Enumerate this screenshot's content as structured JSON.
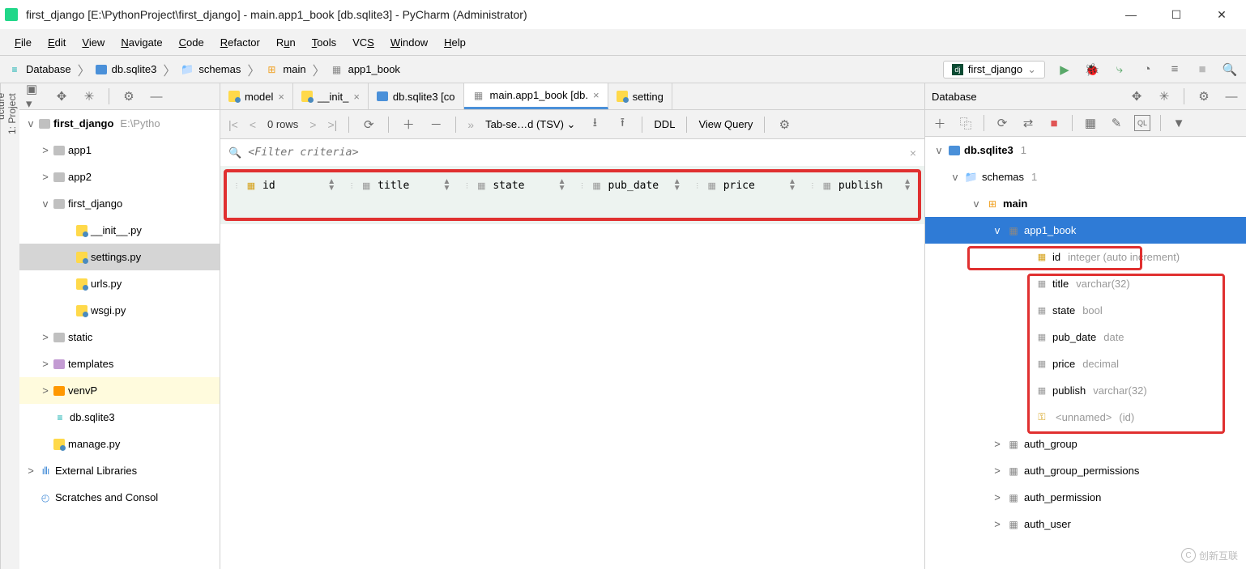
{
  "title": "first_django [E:\\PythonProject\\first_django] - main.app1_book [db.sqlite3] - PyCharm (Administrator)",
  "menubar": [
    "File",
    "Edit",
    "View",
    "Navigate",
    "Code",
    "Refactor",
    "Run",
    "Tools",
    "VCS",
    "Window",
    "Help"
  ],
  "crumbs": [
    {
      "icon": "db",
      "label": "Database"
    },
    {
      "icon": "sqlite",
      "label": "db.sqlite3"
    },
    {
      "icon": "folder",
      "label": "schemas"
    },
    {
      "icon": "schema",
      "label": "main"
    },
    {
      "icon": "table",
      "label": "app1_book"
    }
  ],
  "run_config": "first_django",
  "left_gutter": {
    "tab1": "1: Project",
    "tab2": "ucture"
  },
  "project_tree": {
    "root": {
      "name": "first_django",
      "path": "E:\\Pytho"
    },
    "nodes": [
      {
        "lvl": 1,
        "exp": ">",
        "ic": "greyfolder",
        "label": "app1"
      },
      {
        "lvl": 1,
        "exp": ">",
        "ic": "greyfolder",
        "label": "app2"
      },
      {
        "lvl": 1,
        "exp": "v",
        "ic": "greyfolder",
        "label": "first_django"
      },
      {
        "lvl": 2,
        "exp": "",
        "ic": "pyfile",
        "label": "__init__.py"
      },
      {
        "lvl": 2,
        "exp": "",
        "ic": "pyfile",
        "label": "settings.py",
        "sel": true
      },
      {
        "lvl": 2,
        "exp": "",
        "ic": "pyfile",
        "label": "urls.py"
      },
      {
        "lvl": 2,
        "exp": "",
        "ic": "pyfile",
        "label": "wsgi.py"
      },
      {
        "lvl": 1,
        "exp": ">",
        "ic": "greyfolder",
        "label": "static"
      },
      {
        "lvl": 1,
        "exp": ">",
        "ic": "purplefolder",
        "label": "templates"
      },
      {
        "lvl": 1,
        "exp": ">",
        "ic": "orangefolder",
        "label": "venvP",
        "venv": true
      },
      {
        "lvl": 1,
        "exp": "",
        "ic": "db",
        "label": "db.sqlite3"
      },
      {
        "lvl": 1,
        "exp": "",
        "ic": "pyfile",
        "label": "manage.py"
      }
    ],
    "external": "External Libraries",
    "scratches": "Scratches and Consol"
  },
  "tabs": [
    {
      "ic": "pyfile",
      "label": "model",
      "active": false
    },
    {
      "ic": "pyfile",
      "label": "__init_",
      "active": false
    },
    {
      "ic": "sqlite",
      "label": "db.sqlite3 [co",
      "active": false,
      "noclose": true
    },
    {
      "ic": "table",
      "label": "main.app1_book [db.",
      "active": true
    },
    {
      "ic": "pyfile",
      "label": "setting",
      "active": false,
      "noclose": true
    }
  ],
  "db_toolbar": {
    "rows": "0 rows",
    "format_prefix": "Tab-se…d (TSV)",
    "ddl": "DDL",
    "view_query": "View Query"
  },
  "filter_placeholder": "<Filter criteria>",
  "columns": [
    {
      "ic": "pk",
      "name": "id"
    },
    {
      "ic": "col",
      "name": "title"
    },
    {
      "ic": "col",
      "name": "state"
    },
    {
      "ic": "col",
      "name": "pub_date"
    },
    {
      "ic": "col",
      "name": "price"
    },
    {
      "ic": "col",
      "name": "publish"
    }
  ],
  "db_panel_title": "Database",
  "db_tree": {
    "root": {
      "name": "db.sqlite3",
      "cnt": "1"
    },
    "schemas": {
      "name": "schemas",
      "cnt": "1"
    },
    "main": {
      "name": "main"
    },
    "selected": {
      "name": "app1_book"
    },
    "cols": [
      {
        "ic": "pk",
        "name": "id",
        "ty": "integer (auto increment)"
      },
      {
        "ic": "col",
        "name": "title",
        "ty": "varchar(32)"
      },
      {
        "ic": "col",
        "name": "state",
        "ty": "bool"
      },
      {
        "ic": "col",
        "name": "pub_date",
        "ty": "date"
      },
      {
        "ic": "col",
        "name": "price",
        "ty": "decimal"
      },
      {
        "ic": "col",
        "name": "publish",
        "ty": "varchar(32)"
      }
    ],
    "key": {
      "name": "<unnamed>",
      "ty": "(id)"
    },
    "others": [
      "auth_group",
      "auth_group_permissions",
      "auth_permission",
      "auth_user"
    ]
  },
  "watermark": "创新互联"
}
